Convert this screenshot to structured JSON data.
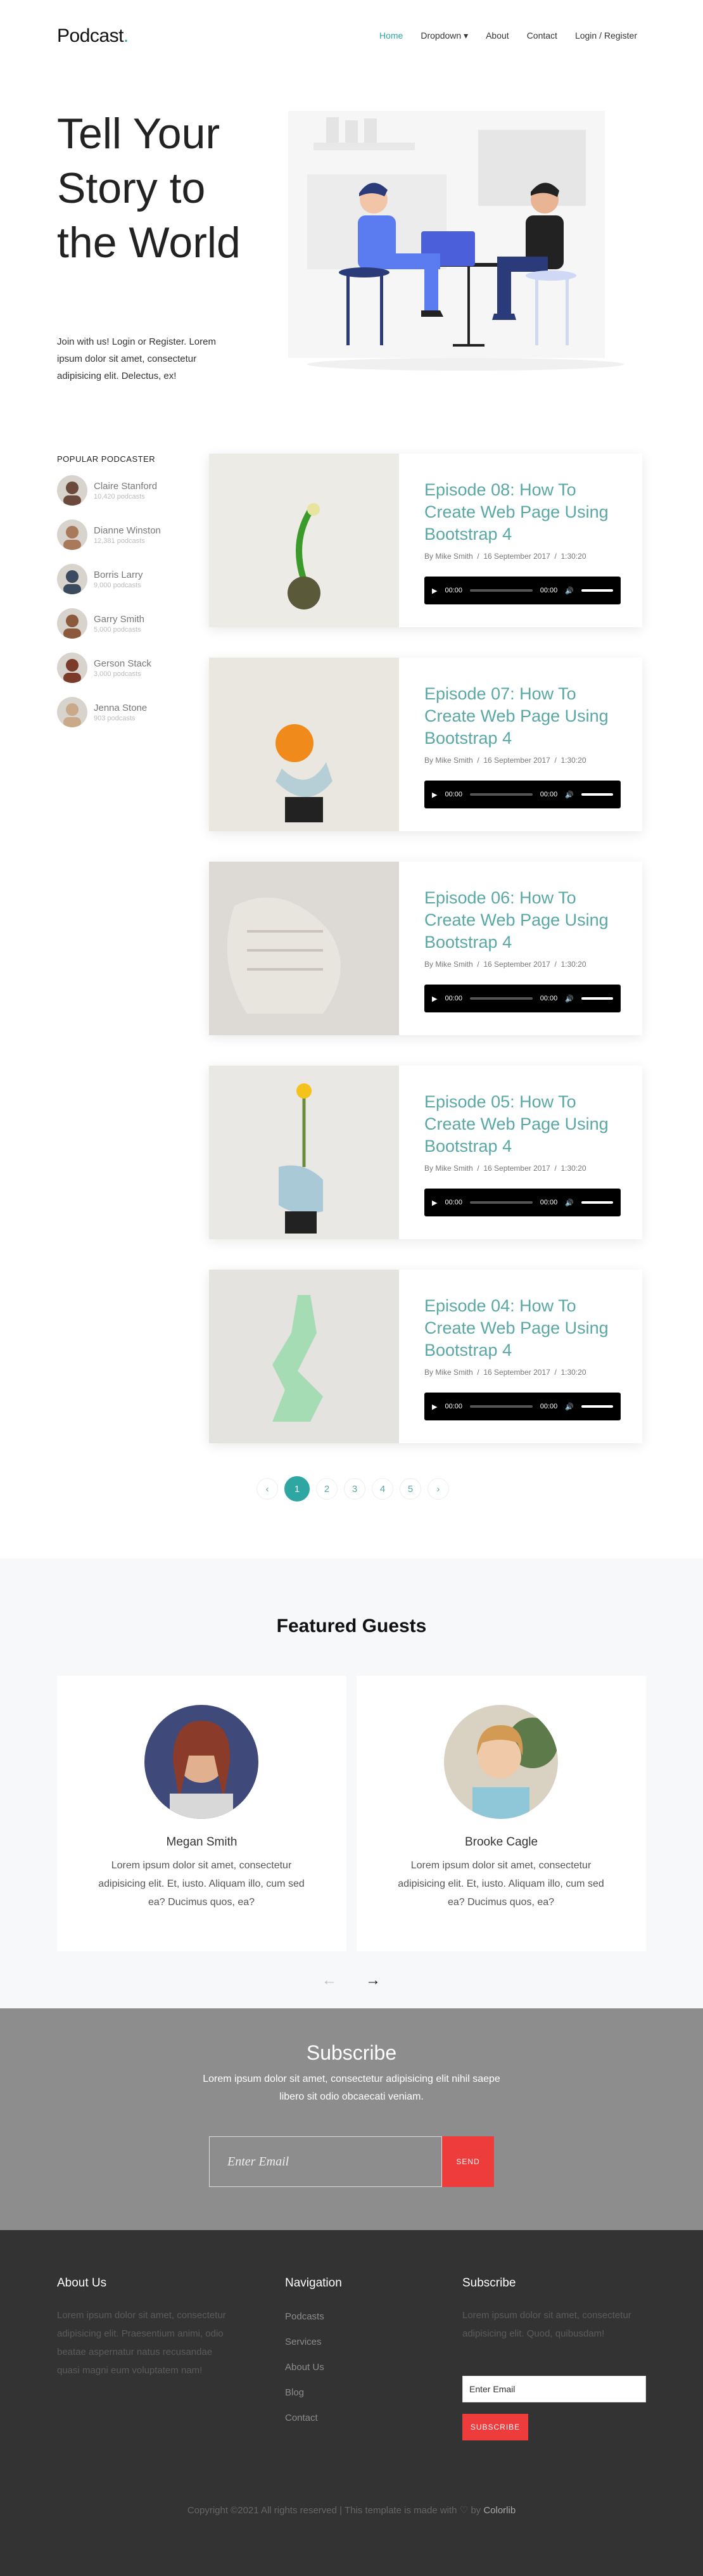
{
  "header": {
    "logo": "Podcast",
    "logo_dot": ".",
    "nav": [
      "Home",
      "Dropdown",
      "About",
      "Contact",
      "Login / Register"
    ]
  },
  "hero": {
    "title": "Tell Your Story to the World",
    "text": "Join with us! Login or Register. Lorem ipsum dolor sit amet, consectetur adipisicing elit. Delectus, ex!"
  },
  "sidebar": {
    "title": "POPULAR PODCASTER",
    "items": [
      {
        "name": "Claire Stanford",
        "count": "10,420 podcasts"
      },
      {
        "name": "Dianne Winston",
        "count": "12,381 podcasts"
      },
      {
        "name": "Borris Larry",
        "count": "9,000 podcasts"
      },
      {
        "name": "Garry Smith",
        "count": "5,000 podcasts"
      },
      {
        "name": "Gerson Stack",
        "count": "3,000 podcasts"
      },
      {
        "name": "Jenna Stone",
        "count": "903 podcasts"
      }
    ]
  },
  "episodes": [
    {
      "title": "Episode 08: How To Create Web Page Using Bootstrap 4",
      "author": "By Mike Smith",
      "date": "16 September 2017",
      "length": "1:30:20",
      "time_start": "00:00",
      "time_end": "00:00"
    },
    {
      "title": "Episode 07: How To Create Web Page Using Bootstrap 4",
      "author": "By Mike Smith",
      "date": "16 September 2017",
      "length": "1:30:20",
      "time_start": "00:00",
      "time_end": "00:00"
    },
    {
      "title": "Episode 06: How To Create Web Page Using Bootstrap 4",
      "author": "By Mike Smith",
      "date": "16 September 2017",
      "length": "1:30:20",
      "time_start": "00:00",
      "time_end": "00:00"
    },
    {
      "title": "Episode 05: How To Create Web Page Using Bootstrap 4",
      "author": "By Mike Smith",
      "date": "16 September 2017",
      "length": "1:30:20",
      "time_start": "00:00",
      "time_end": "00:00"
    },
    {
      "title": "Episode 04: How To Create Web Page Using Bootstrap 4",
      "author": "By Mike Smith",
      "date": "16 September 2017",
      "length": "1:30:20",
      "time_start": "00:00",
      "time_end": "00:00"
    }
  ],
  "meta_sep": "/",
  "pagination": {
    "prev": "‹",
    "pages": [
      "1",
      "2",
      "3",
      "4",
      "5"
    ],
    "next": "›",
    "current": "1"
  },
  "featured": {
    "title": "Featured Guests",
    "guests": [
      {
        "name": "Megan Smith",
        "text": "Lorem ipsum dolor sit amet, consectetur adipisicing elit. Et, iusto. Aliquam illo, cum sed ea? Ducimus quos, ea?"
      },
      {
        "name": "Brooke Cagle",
        "text": "Lorem ipsum dolor sit amet, consectetur adipisicing elit. Et, iusto. Aliquam illo, cum sed ea? Ducimus quos, ea?"
      }
    ],
    "prev_arrow": "←",
    "next_arrow": "→"
  },
  "subscribe": {
    "title": "Subscribe",
    "text": "Lorem ipsum dolor sit amet, consectetur adipisicing elit nihil saepe libero sit odio obcaecati veniam.",
    "placeholder": "Enter Email",
    "button": "SEND"
  },
  "footer": {
    "about_title": "About Us",
    "about_text": "Lorem ipsum dolor sit amet, consectetur adipisicing elit. Praesentium animi, odio beatae aspernatur natus recusandae quasi magni eum voluptatem nam!",
    "nav_title": "Navigation",
    "nav_links": [
      "Podcasts",
      "Services",
      "About Us",
      "Blog",
      "Contact"
    ],
    "sub_title": "Subscribe",
    "sub_text": "Lorem ipsum dolor sit amet, consectetur adipisicing elit. Quod, quibusdam!",
    "sub_placeholder": "Enter Email",
    "sub_button": "SUBSCRIBE",
    "copyright": "Copyright ©2021 All rights reserved | This template is made with",
    "copyright_by": "by",
    "copyright_brand": "Colorlib"
  },
  "colors": {
    "accent": "#2ea6a2",
    "red": "#ee3b3b",
    "footer": "#333333",
    "subscribe_bg": "#8d8d8d"
  },
  "icons": [
    "chevron-down-icon",
    "play-icon",
    "volume-icon",
    "heart-icon",
    "arrow-left-icon",
    "arrow-right-icon"
  ]
}
